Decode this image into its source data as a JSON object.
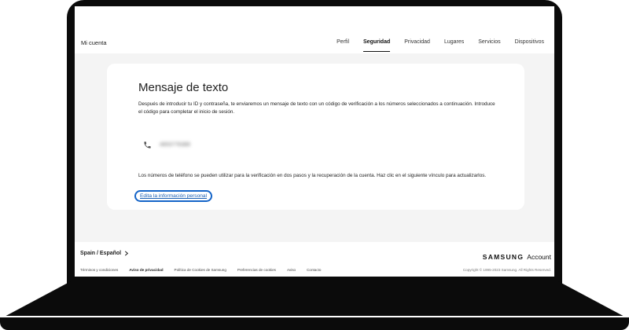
{
  "header": {
    "title": "Mi cuenta",
    "nav": [
      {
        "label": "Perfil",
        "active": false
      },
      {
        "label": "Seguridad",
        "active": true
      },
      {
        "label": "Privacidad",
        "active": false
      },
      {
        "label": "Lugares",
        "active": false
      },
      {
        "label": "Servicios",
        "active": false
      },
      {
        "label": "Dispositivos",
        "active": false
      }
    ]
  },
  "card": {
    "title": "Mensaje de texto",
    "description": "Después de introducir tu ID y contraseña, te enviaremos un mensaje de texto con un código de verificación a los números seleccionados a continuación. Introduce el código para completar el inicio de sesión.",
    "phone": {
      "icon": "phone-icon",
      "number": "4653776389"
    },
    "info": "Los números de teléfono se pueden utilizar para la verificación en dos pasos y la recuperación de la cuenta. Haz clic en el siguiente vínculo para actualizarlos.",
    "link": "Edita la información personal"
  },
  "footer": {
    "region": "Spain / Español",
    "links": [
      {
        "label": "Términos y condiciones",
        "bold": false
      },
      {
        "label": "Aviso de privacidad",
        "bold": true
      },
      {
        "label": "Política de Cookies de Samsung",
        "bold": false
      },
      {
        "label": "Preferencias de cookies",
        "bold": false
      },
      {
        "label": "Aviso",
        "bold": false
      },
      {
        "label": "Contacto",
        "bold": false
      }
    ],
    "logo_samsung": "SAMSUNG",
    "logo_account": "Account",
    "copyright": "Copyright © 1995-2023 Samsung. All Rights Reserved."
  },
  "colors": {
    "frame": "#0b0b0b",
    "screen_bg": "#f4f4f4",
    "link": "#1a5fb4",
    "highlight": "#1464c8"
  }
}
